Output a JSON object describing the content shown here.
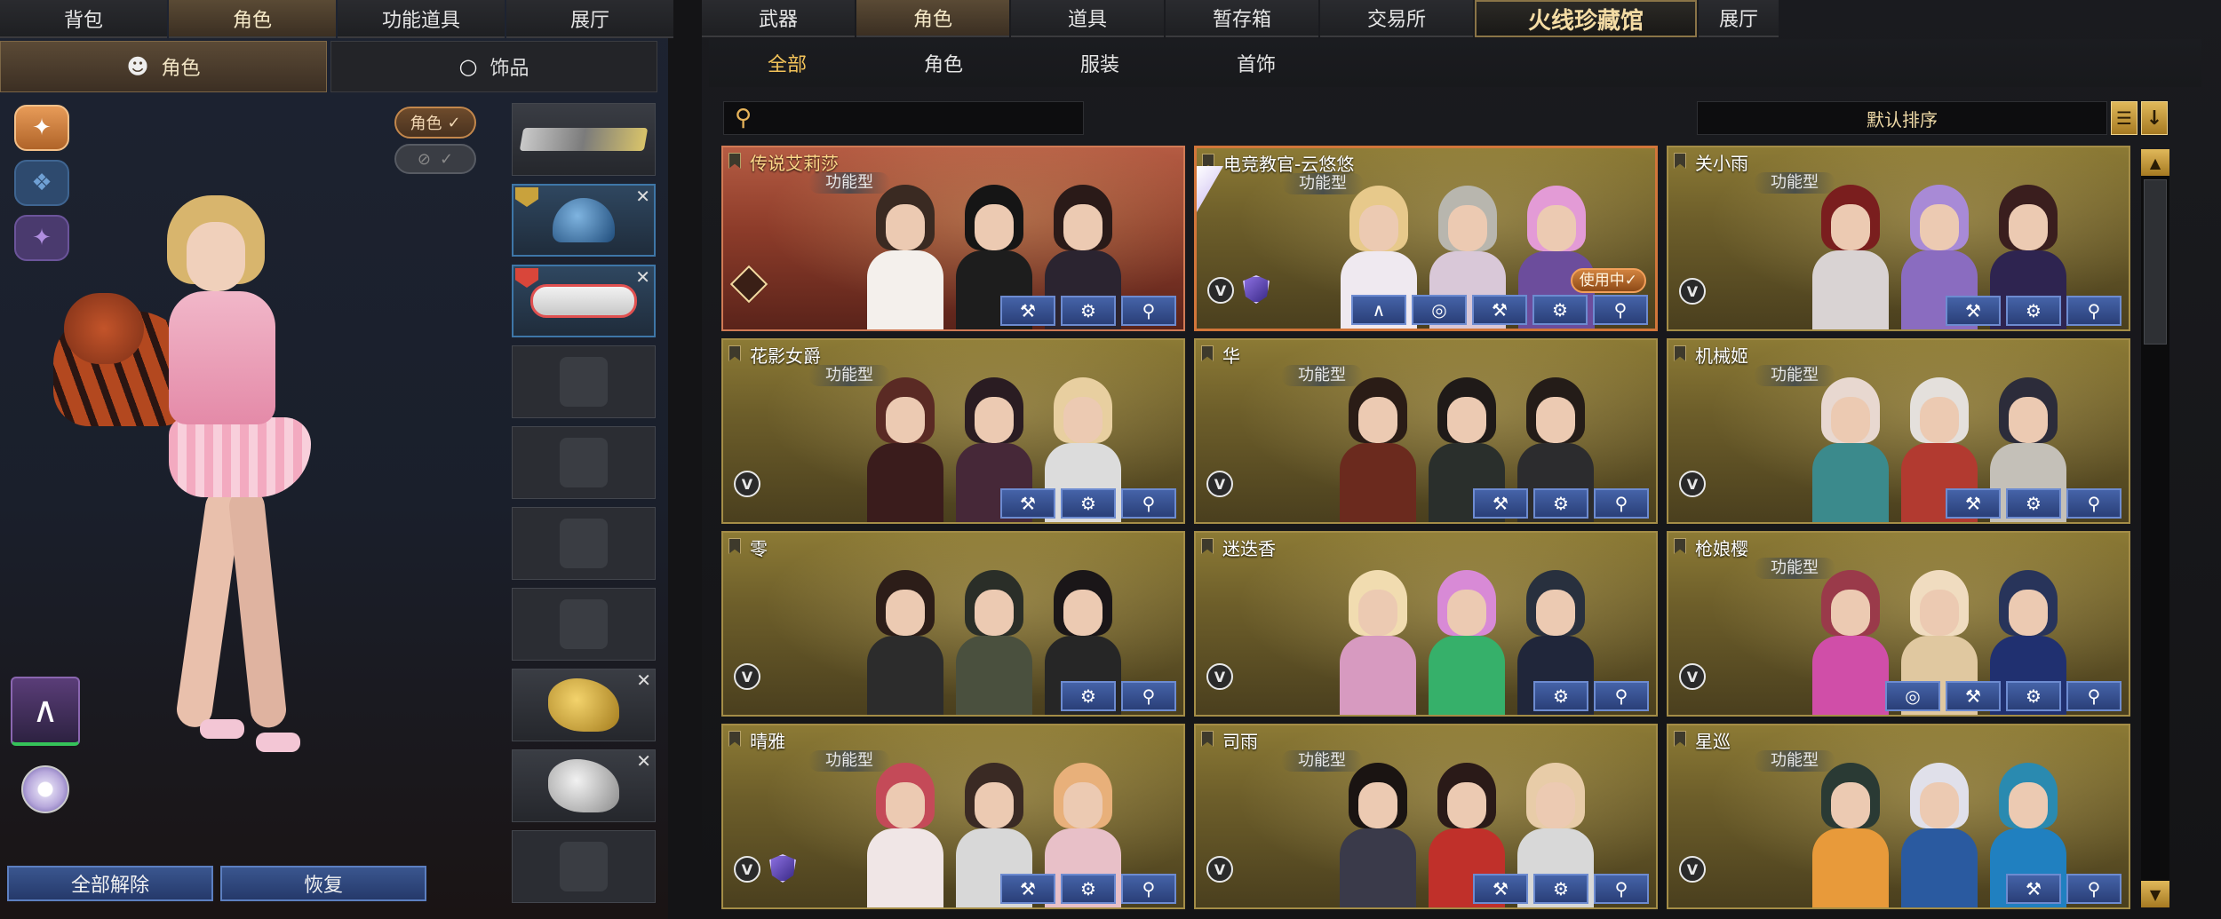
{
  "left": {
    "top_tabs": [
      "背包",
      "角色",
      "功能道具",
      "展厅"
    ],
    "top_tab_active": 1,
    "sub_tabs": {
      "role": "角色",
      "accessory": "饰品"
    },
    "role_toggle_label": "角色",
    "check": "✓",
    "bottom_buttons": {
      "unequip_all": "全部解除",
      "restore": "恢复"
    }
  },
  "right": {
    "tabs": [
      "武器",
      "角色",
      "道具",
      "暂存箱",
      "交易所",
      "火线珍藏馆",
      "展厅"
    ],
    "tab_active": 1,
    "filters": [
      "全部",
      "角色",
      "服装",
      "首饰"
    ],
    "filter_active": 0,
    "search_placeholder": "",
    "sort_label": "默认排序",
    "cards": [
      {
        "name": "传说艾莉莎",
        "pill": "功能型",
        "in_use": ""
      },
      {
        "name": "电竞教官-云悠悠",
        "pill": "功能型",
        "in_use": "使用中✓"
      },
      {
        "name": "关小雨",
        "pill": "功能型",
        "in_use": ""
      },
      {
        "name": "花影女爵",
        "pill": "功能型",
        "in_use": ""
      },
      {
        "name": "华",
        "pill": "功能型",
        "in_use": ""
      },
      {
        "name": "机械姬",
        "pill": "功能型",
        "in_use": ""
      },
      {
        "name": "零",
        "pill": "",
        "in_use": ""
      },
      {
        "name": "迷迭香",
        "pill": "",
        "in_use": ""
      },
      {
        "name": "枪娘樱",
        "pill": "功能型",
        "in_use": ""
      },
      {
        "name": "晴雅",
        "pill": "功能型",
        "in_use": ""
      },
      {
        "name": "司雨",
        "pill": "功能型",
        "in_use": ""
      },
      {
        "name": "星巡",
        "pill": "功能型",
        "in_use": ""
      }
    ]
  },
  "colors": {
    "accent_gold": "#f3c35a",
    "card_gold": "#8c7a35",
    "card_legend": "#b55c43",
    "action_blue": "#4563a8",
    "in_use_orange": "#d2833f"
  },
  "icons": {
    "search": "search-icon",
    "wrench": "wrench-icon",
    "gear": "gear-icon",
    "magnify": "magnify-icon",
    "hanger": "hanger-icon",
    "disc": "disc-icon"
  }
}
